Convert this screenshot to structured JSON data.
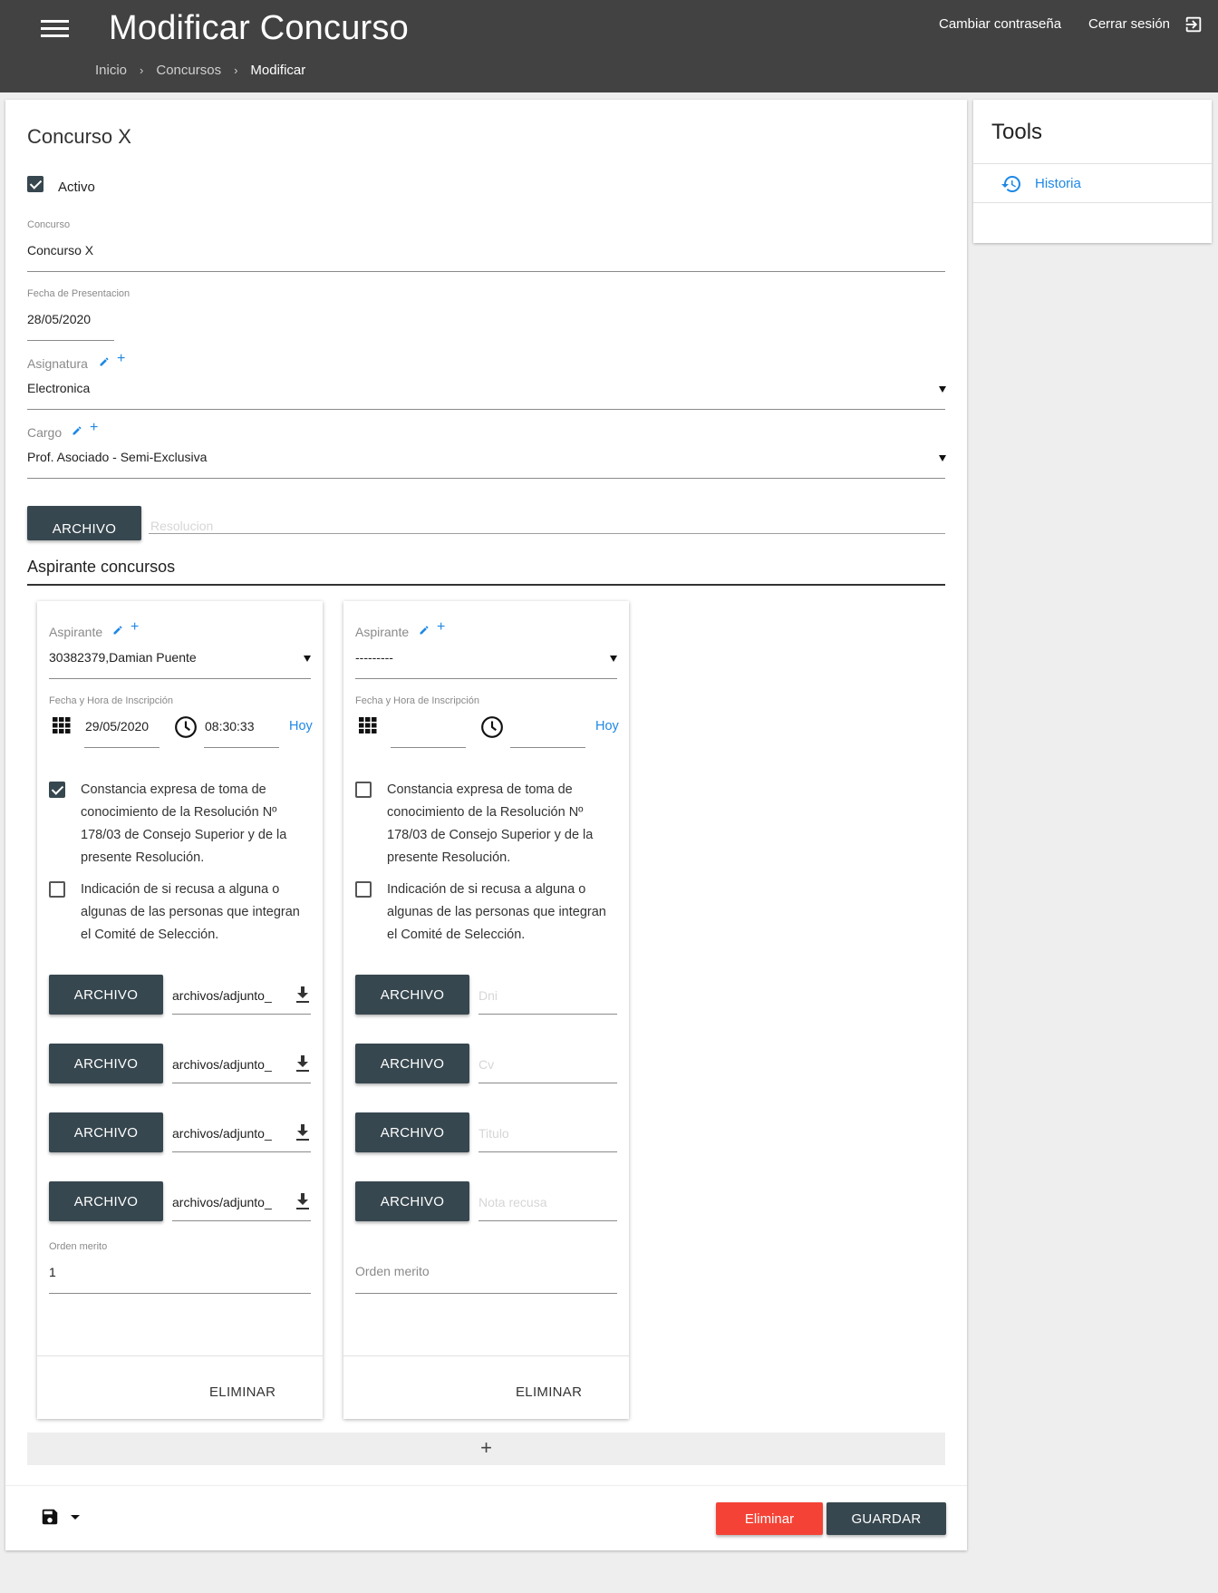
{
  "header": {
    "title": "Modificar Concurso",
    "breadcrumb": [
      "Inicio",
      "Concursos",
      "Modificar"
    ],
    "change_password": "Cambiar contraseña",
    "logout": "Cerrar sesión"
  },
  "form": {
    "title": "Concurso X",
    "activo_label": "Activo",
    "activo_checked": true,
    "concurso_label": "Concurso",
    "concurso_value": "Concurso X",
    "fecha_label": "Fecha de Presentacion",
    "fecha_value": "28/05/2020",
    "asignatura_label": "Asignatura",
    "asignatura_value": "Electronica",
    "cargo_label": "Cargo",
    "cargo_value": "Prof. Asociado - Semi-Exclusiva",
    "archivo_label": "ARCHIVO",
    "resolucion_placeholder": "Resolucion",
    "section_title": "Aspirante concursos"
  },
  "aspirants": [
    {
      "aspirante_label": "Aspirante",
      "aspirante_value": "30382379,Damian Puente",
      "fecha_hora_label": "Fecha y Hora de Inscripción",
      "date": "29/05/2020",
      "time": "08:30:33",
      "hoy": "Hoy",
      "constancia_checked": true,
      "constancia_text": "Constancia expresa de toma de conocimiento de la Resolución Nº 178/03 de Consejo Superior y de la presente Resolución.",
      "recusa_checked": false,
      "recusa_text": "Indicación de si recusa a alguna o algunas de las personas que integran el Comité de Selección.",
      "files": [
        {
          "button": "ARCHIVO",
          "value": "archivos/adjunto_"
        },
        {
          "button": "ARCHIVO",
          "value": "archivos/adjunto_"
        },
        {
          "button": "ARCHIVO",
          "value": "archivos/adjunto_"
        },
        {
          "button": "ARCHIVO",
          "value": "archivos/adjunto_"
        }
      ],
      "orden_label": "Orden merito",
      "orden_value": "1",
      "eliminar": "ELIMINAR"
    },
    {
      "aspirante_label": "Aspirante",
      "aspirante_value": "---------",
      "fecha_hora_label": "Fecha y Hora de Inscripción",
      "date": "",
      "time": "",
      "hoy": "Hoy",
      "constancia_checked": false,
      "constancia_text": "Constancia expresa de toma de conocimiento de la Resolución Nº 178/03 de Consejo Superior y de la presente Resolución.",
      "recusa_checked": false,
      "recusa_text": "Indicación de si recusa a alguna o algunas de las personas que integran el Comité de Selección.",
      "files": [
        {
          "button": "ARCHIVO",
          "placeholder": "Dni"
        },
        {
          "button": "ARCHIVO",
          "placeholder": "Cv"
        },
        {
          "button": "ARCHIVO",
          "placeholder": "Titulo"
        },
        {
          "button": "ARCHIVO",
          "placeholder": "Nota recusa"
        }
      ],
      "orden_placeholder": "Orden merito",
      "eliminar": "ELIMINAR"
    }
  ],
  "actions": {
    "add": "+",
    "eliminar": "Eliminar",
    "guardar": "GUARDAR"
  },
  "tools": {
    "title": "Tools",
    "historia": "Historia"
  },
  "colors": {
    "header_bg": "#424242",
    "button_dark": "#37474f",
    "danger": "#f44336",
    "link": "#1e88e5"
  }
}
